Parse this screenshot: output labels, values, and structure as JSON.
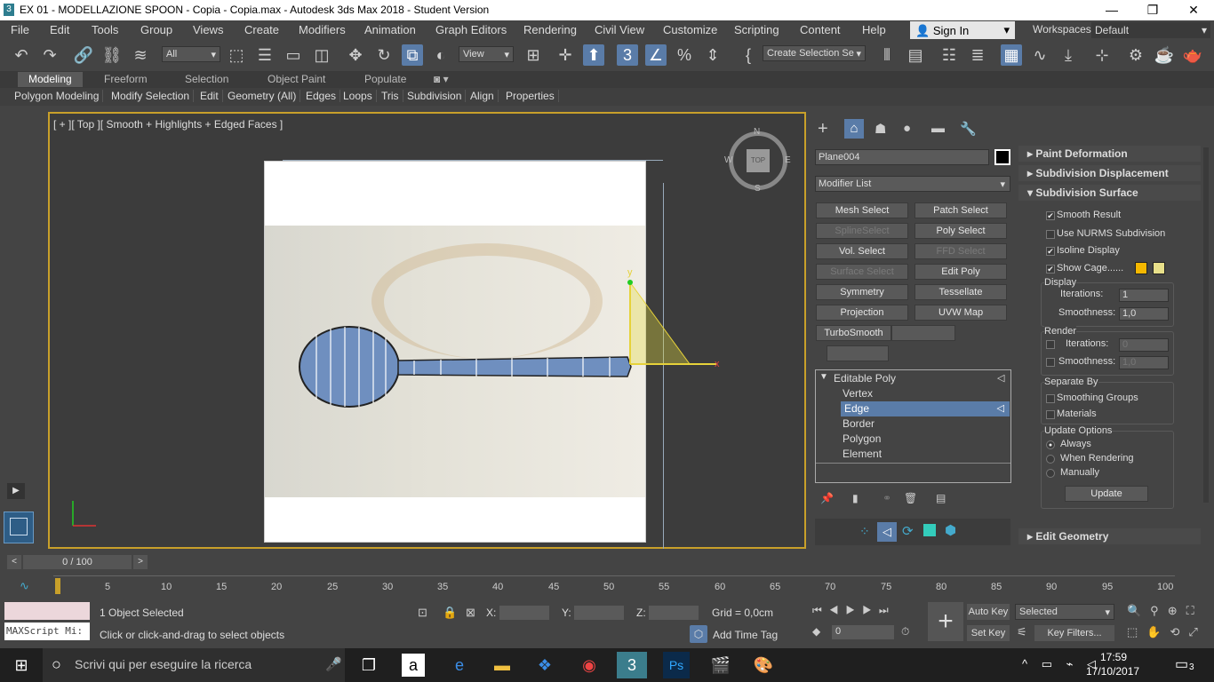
{
  "window": {
    "title": "EX 01 - MODELLAZIONE SPOON - Copia - Copia.max - Autodesk 3ds Max 2018 - Student Version",
    "min_label": "—",
    "max_label": "❐",
    "close_label": "✕"
  },
  "menu": {
    "items": [
      "File",
      "Edit",
      "Tools",
      "Group",
      "Views",
      "Create",
      "Modifiers",
      "Animation",
      "Graph Editors",
      "Rendering",
      "Civil View",
      "Customize",
      "Scripting",
      "Content",
      "Help"
    ],
    "sign_in": "Sign In",
    "workspaces_label": "Workspaces:",
    "workspaces_value": "Default"
  },
  "toolbar": {
    "filter_value": "All",
    "coord_value": "View",
    "selection_set_value": "Create Selection Se"
  },
  "ribbon": {
    "tabs": [
      "Modeling",
      "Freeform",
      "Selection",
      "Object Paint",
      "Populate"
    ],
    "subtabs": [
      "Polygon Modeling",
      "Modify Selection",
      "Edit",
      "Geometry (All)",
      "Edges",
      "Loops",
      "Tris",
      "Subdivision",
      "Align",
      "Properties"
    ]
  },
  "viewport": {
    "label": "[ + ][ Top ][ Smooth + Highlights + Edged Faces ]",
    "viewcube_face": "TOP",
    "compass": {
      "n": "N",
      "s": "S",
      "e": "E",
      "w": "W"
    },
    "gizmo_y": "y",
    "gizmo_x": "x"
  },
  "command_panel": {
    "object_name": "Plane004",
    "modifier_list_label": "Modifier List",
    "buttons": [
      {
        "label": "Mesh Select",
        "enabled": true
      },
      {
        "label": "Patch Select",
        "enabled": true
      },
      {
        "label": "SplineSelect",
        "enabled": false
      },
      {
        "label": "Poly Select",
        "enabled": true
      },
      {
        "label": "Vol. Select",
        "enabled": true
      },
      {
        "label": "FFD Select",
        "enabled": false
      },
      {
        "label": "Surface Select",
        "enabled": false
      },
      {
        "label": "Edit Poly",
        "enabled": true
      },
      {
        "label": "Symmetry",
        "enabled": true
      },
      {
        "label": "Tessellate",
        "enabled": true
      },
      {
        "label": "Projection",
        "enabled": true
      },
      {
        "label": "UVW Map",
        "enabled": true
      },
      {
        "label": "TurboSmooth",
        "enabled": true
      }
    ],
    "stack": {
      "root": "Editable Poly",
      "items": [
        "Vertex",
        "Edge",
        "Border",
        "Polygon",
        "Element"
      ],
      "selected": "Edge"
    }
  },
  "rollouts": {
    "paint_deformation": "Paint Deformation",
    "subdivision_displacement": "Subdivision Displacement",
    "subdivision_surface": "Subdivision Surface",
    "smooth_result": "Smooth Result",
    "use_nurms": "Use NURMS Subdivision",
    "isoline_display": "Isoline Display",
    "show_cage": "Show Cage......",
    "display_group": "Display",
    "iterations_label": "Iterations:",
    "iterations_value": "1",
    "smoothness_label": "Smoothness:",
    "smoothness_value": "1,0",
    "render_group": "Render",
    "render_iterations_value": "0",
    "render_smoothness_value": "1,0",
    "separate_by": "Separate By",
    "smoothing_groups": "Smoothing Groups",
    "materials": "Materials",
    "update_options": "Update Options",
    "always": "Always",
    "when_rendering": "When Rendering",
    "manually": "Manually",
    "update_button": "Update",
    "edit_geometry": "Edit Geometry",
    "cage_color_1": "#f5b800",
    "cage_color_2": "#e8e08a"
  },
  "timeline": {
    "frame_label": "0 / 100",
    "ticks": [
      "5",
      "10",
      "15",
      "20",
      "25",
      "30",
      "35",
      "40",
      "45",
      "50",
      "55",
      "60",
      "65",
      "70",
      "75",
      "80",
      "85",
      "90",
      "95",
      "100"
    ]
  },
  "status": {
    "script_placeholder": "MAXScript Mi:",
    "selected_text": "1 Object Selected",
    "prompt_text": "Click or click-and-drag to select objects",
    "x_label": "X:",
    "y_label": "Y:",
    "z_label": "Z:",
    "grid_text": "Grid = 0,0cm",
    "add_time_tag": "Add Time Tag",
    "auto_key": "Auto Key",
    "set_key": "Set Key",
    "selected_dropdown": "Selected",
    "key_filters": "Key Filters...",
    "frame_value": "0"
  },
  "taskbar": {
    "search_placeholder": "Scrivi qui per eseguire la ricerca",
    "time": "17:59",
    "date": "17/10/2017",
    "notif_count": "3"
  }
}
